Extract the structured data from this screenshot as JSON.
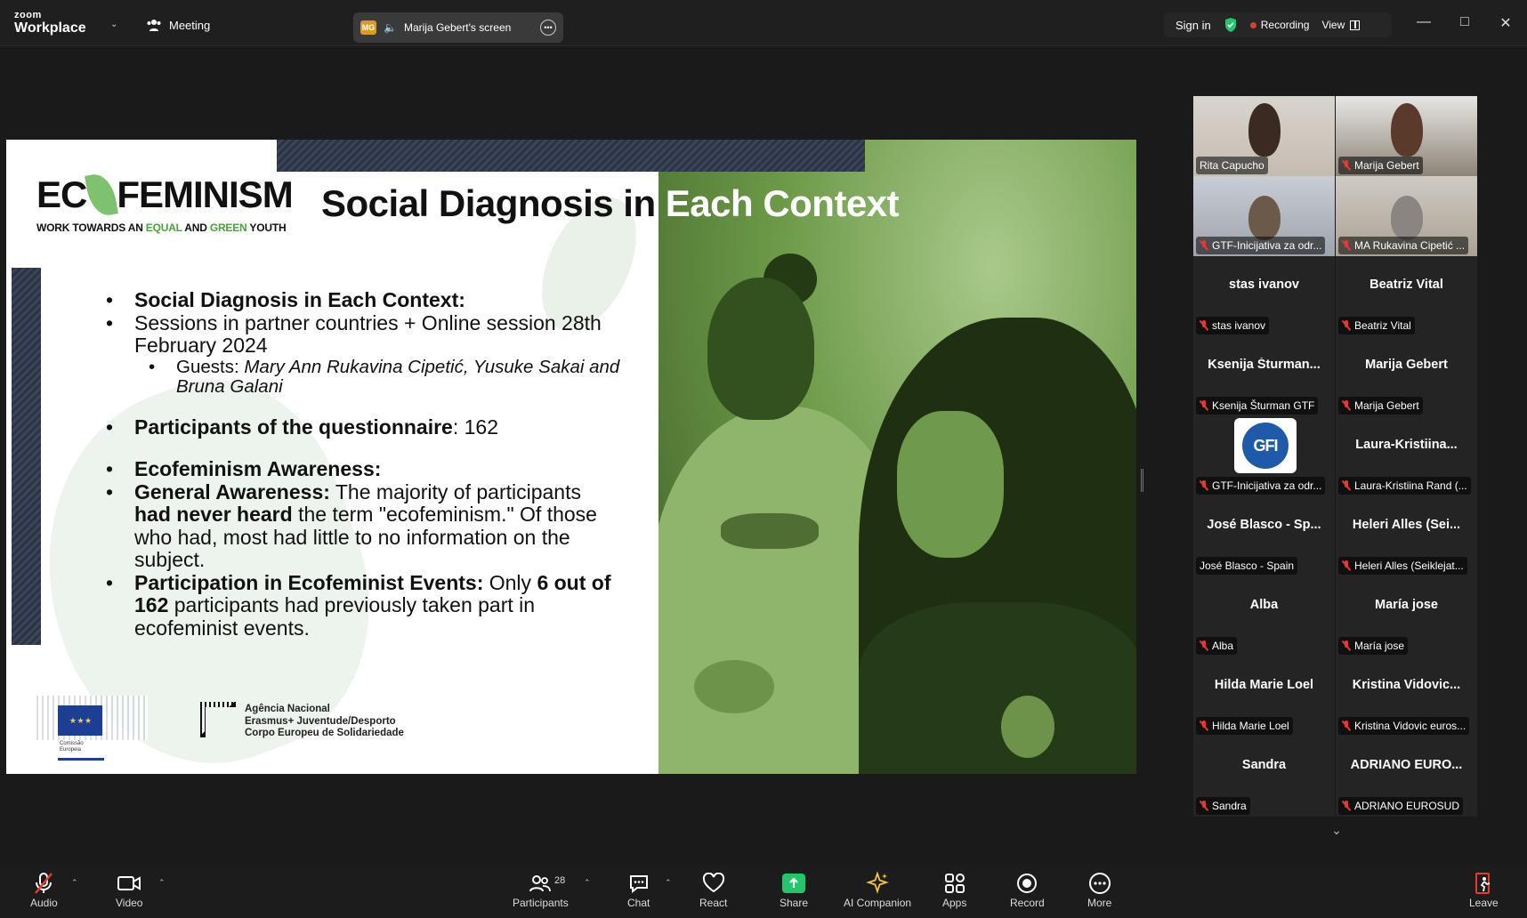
{
  "titlebar": {
    "logo_top": "zoom",
    "logo_bottom": "Workplace",
    "meeting_label": "Meeting",
    "screen_badge": "MG",
    "screen_label": "Marija Gebert's screen",
    "sign_in": "Sign in",
    "recording": "Recording",
    "view": "View"
  },
  "slide": {
    "brand_left": "EC",
    "brand_right": "FEMINISM",
    "brand_sub_1": "WORK TOWARDS AN ",
    "brand_sub_equal": "EQUAL",
    "brand_sub_2": " AND ",
    "brand_sub_green": "GREEN",
    "brand_sub_3": " YOUTH",
    "title_part1": "Social Diagnosis in ",
    "title_part2": "Each Context",
    "b1": "Social Diagnosis in Each Context:",
    "b2": "Sessions in partner countries + Online session 28th February 2024",
    "sub_guests_label": "Guests: ",
    "sub_guests_names": "Mary Ann Rukavina Cipetić, Yusuke Sakai and Bruna Galani",
    "b3_bold": "Participants of the questionnaire",
    "b3_rest": ": 162",
    "b4": "Ecofeminism Awareness:",
    "b5_bold": "General Awareness:",
    "b5_a": " The majority of participants ",
    "b5_bold2": "had never heard",
    "b5_b": " the term \"ecofeminism.\" Of those who had, most had little to no information on the subject.",
    "b6_bold": "Participation in Ecofeminist Events:",
    "b6_a": " Only ",
    "b6_bold2": "6 out of 162",
    "b6_b": " participants had previously taken part in ecofeminist events.",
    "eu_label_1": "Comissão",
    "eu_label_2": "Europeia",
    "agency_1": "Agência Nacional",
    "agency_2": "Erasmus+ Juventude/Desporto",
    "agency_3": "Corpo Europeu de Solidariedade"
  },
  "participants": [
    {
      "name": "",
      "label": "Rita Capucho",
      "video": true,
      "muted": false,
      "active": true
    },
    {
      "name": "",
      "label": "Marija Gebert",
      "video": true,
      "muted": true
    },
    {
      "name": "",
      "label": "GTF-Inicijativa za odr...",
      "video": true,
      "muted": true
    },
    {
      "name": "",
      "label": "MA Rukavina Cipetić ...",
      "video": true,
      "muted": true
    },
    {
      "name": "stas ivanov",
      "label": "stas ivanov",
      "muted": true
    },
    {
      "name": "Beatriz Vital",
      "label": "Beatriz Vital",
      "muted": true
    },
    {
      "name": "Ksenija  Šturman...",
      "label": "Ksenija Šturman GTF",
      "muted": true
    },
    {
      "name": "Marija Gebert",
      "label": "Marija Gebert",
      "muted": true
    },
    {
      "name": "",
      "label": "GTF-Inicijativa za odr...",
      "logo": "GFI",
      "muted": true
    },
    {
      "name": "Laura-Kristiina...",
      "label": "Laura-Kristiina Rand (...",
      "muted": true
    },
    {
      "name": "José Blasco - Sp...",
      "label": "José Blasco - Spain",
      "muted": false
    },
    {
      "name": "Heleri  Alles  (Sei...",
      "label": "Heleri Alles (Seiklejat...",
      "muted": true
    },
    {
      "name": "Alba",
      "label": "Alba",
      "muted": true
    },
    {
      "name": "María jose",
      "label": "María jose",
      "muted": true
    },
    {
      "name": "Hilda Marie Loel",
      "label": "Hilda Marie Loel",
      "muted": true
    },
    {
      "name": "Kristina  Vidovic...",
      "label": "Kristina Vidovic euros...",
      "muted": true
    },
    {
      "name": "Sandra",
      "label": "Sandra",
      "muted": true
    },
    {
      "name": "ADRIANO  EURO...",
      "label": "ADRIANO EUROSUD",
      "muted": true
    }
  ],
  "toolbar": {
    "audio": "Audio",
    "video": "Video",
    "participants": "Participants",
    "participants_count": "28",
    "chat": "Chat",
    "react": "React",
    "share": "Share",
    "ai": "AI Companion",
    "apps": "Apps",
    "record": "Record",
    "more": "More",
    "leave": "Leave"
  },
  "colors": {
    "accent_green": "#23c66a",
    "recording_red": "#e53935",
    "active_speaker": "#2ecc71"
  }
}
